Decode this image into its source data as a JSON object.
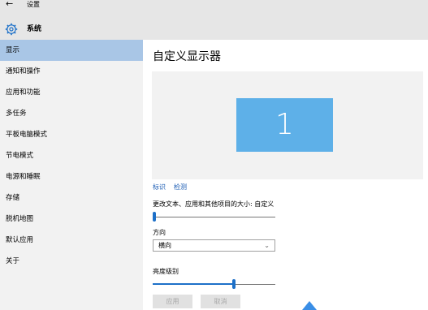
{
  "titlebar": {
    "back_glyph": "←",
    "title": "设置"
  },
  "header": {
    "title": "系统",
    "icon": "gear-icon"
  },
  "sidebar": {
    "items": [
      {
        "label": "显示",
        "active": true
      },
      {
        "label": "通知和操作"
      },
      {
        "label": "应用和功能"
      },
      {
        "label": "多任务"
      },
      {
        "label": "平板电脑模式"
      },
      {
        "label": "节电模式"
      },
      {
        "label": "电源和睡眠"
      },
      {
        "label": "存储"
      },
      {
        "label": "脱机地图"
      },
      {
        "label": "默认应用"
      },
      {
        "label": "关于"
      }
    ]
  },
  "main": {
    "title": "自定义显示器",
    "monitor_number": "1",
    "identify_link": "标识",
    "detect_link": "检测",
    "scale_label": "更改文本、应用和其他项目的大小: 自定义",
    "scale_level": 0,
    "orientation_label": "方向",
    "orientation_value": "横向",
    "brightness_label": "亮度级别",
    "brightness_level": 0.67,
    "apply_button": "应用",
    "cancel_button": "取消"
  },
  "colors": {
    "accent": "#1d70c8",
    "monitor_tile": "#5eb0e8",
    "active_nav": "#a9c6e6",
    "link": "#1a5bb3"
  }
}
